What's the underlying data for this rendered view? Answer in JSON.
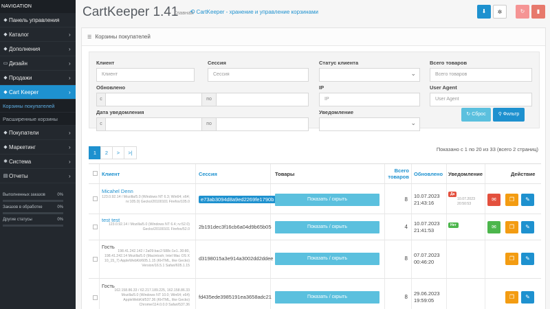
{
  "sidebar": {
    "nav_header": "NAVIGATION",
    "items": [
      {
        "icon": "dashboard-icon",
        "glyph": "◆",
        "label": "Панель управления",
        "chevron": ""
      },
      {
        "icon": "tags-icon",
        "glyph": "◆",
        "label": "Каталог",
        "chevron": "›"
      },
      {
        "icon": "puzzle-icon",
        "glyph": "◆",
        "label": "Дополнения",
        "chevron": "›"
      },
      {
        "icon": "desktop-icon",
        "glyph": "▭",
        "label": "Дизайн",
        "chevron": "›"
      },
      {
        "icon": "cart-icon",
        "glyph": "◆",
        "label": "Продажи",
        "chevron": "›"
      },
      {
        "icon": "cart-keeper-icon",
        "glyph": "◆",
        "label": "Cart Keeper",
        "chevron": "›"
      },
      {
        "icon": "users-icon",
        "glyph": "◆",
        "label": "Покупатели",
        "chevron": "›"
      },
      {
        "icon": "share-icon",
        "glyph": "◆",
        "label": "Маркетинг",
        "chevron": "›"
      },
      {
        "icon": "cog-icon",
        "glyph": "✱",
        "label": "Система",
        "chevron": "›"
      },
      {
        "icon": "bar-chart-icon",
        "glyph": "▤",
        "label": "Отчеты",
        "chevron": "›"
      }
    ],
    "sub_items": [
      "Корзины покупателей",
      "Расширенные корзины"
    ],
    "stats": [
      {
        "label": "Выполненных заказов",
        "pct": "0%"
      },
      {
        "label": "Заказов в обработке",
        "pct": "0%"
      },
      {
        "label": "Другие статусы",
        "pct": "0%"
      }
    ]
  },
  "header": {
    "title": "CartKeeper 1.41",
    "crumb_home": "Главная",
    "crumb_link": "CartKeeper - хранение и управление корзинами",
    "buttons": [
      "download-icon",
      "settings-icon",
      "refresh-icon",
      "trash-icon"
    ]
  },
  "panel": {
    "title": "Корзины покупателей"
  },
  "filter": {
    "client_label": "Клиент",
    "client_placeholder": "Клиент",
    "session_label": "Сессия",
    "session_placeholder": "Сессия",
    "status_label": "Статус клиента",
    "status_value": "",
    "total_label": "Всего товаров",
    "total_placeholder": "Всего товаров",
    "updated_label": "Обновлено",
    "updated_from": "с",
    "updated_to": "по",
    "ip_label": "IP",
    "ip_placeholder": "IP",
    "ua_label": "User Agent",
    "ua_placeholder": "User Agent",
    "notify_date_label": "Дата уведомления",
    "notify_from": "с",
    "notify_to": "по",
    "notify_label": "Уведомление",
    "notify_value": "",
    "reset_label": "↻ Сброс",
    "filter_label": "Фильтр"
  },
  "pagination": {
    "pages": [
      "1",
      "2",
      ">",
      ">|"
    ],
    "info": "Показано с 1 по 20 из 33 (всего 2 страниц)"
  },
  "table": {
    "headers": {
      "client": "Клиент",
      "session": "Сессия",
      "products": "Товары",
      "total": "Всего товаров",
      "updated": "Обновлено",
      "notify": "Уведомление",
      "action": "Действие"
    },
    "toggle_label": "Показать / скрыть",
    "rows": [
      {
        "name": "Micahel Denn",
        "meta": "123.0.92.14 / Mozilla/5.0 (Windows NT 6.3; Win64; x64; rv:105.0) Gecko/20100101 Firefox/105.0",
        "session": "e73ab3094d8a9ed2269fe1790b",
        "qty": "8",
        "updated_date": "10.07.2023",
        "updated_time": "21:43:16",
        "notify_badge": "Да",
        "notify_date": "10.07.2023",
        "notify_time": "20:50:53"
      },
      {
        "name": "test test",
        "meta": "123.0.92.14 / Mozilla/5.0 (Windows NT 6.4; rv:52.0) Gecko/20100101 Firefox/52.0",
        "session": "2b191dec3f16cb6a04d9b65b05",
        "qty": "4",
        "updated_date": "10.07.2023",
        "updated_time": "21:41:53",
        "notify_badge": "Нет",
        "notify_date": "",
        "notify_time": ""
      },
      {
        "name": "Гость",
        "meta": "198.41.242.142 / 2a09:bac2:588c:1e1..30:80, 198.41.242.14 Mozilla/5.0 (Macintosh; Intel Mac OS X 10_15_7) AppleWebKit/605.1.15 (KHTML, like Gecko) Version/16.5.1 Safari/605.1.15",
        "session": "d3198015a3e914a3002dd2ddee",
        "qty": "8",
        "updated_date": "07.07.2023",
        "updated_time": "00:46:20",
        "notify_badge": "",
        "notify_date": "",
        "notify_time": ""
      },
      {
        "name": "Гость",
        "meta": "162.158.86.33 / 62.217.189.225, 162.158.86.33 Mozilla/5.0 (Windows NT 10.0; Win64; x64) AppleWebKit/537.36 (KHTML, like Gecko) Chrome/114.0.0.0 Safari/537.36",
        "session": "fd435ede3985191ea3658adc21",
        "qty": "8",
        "updated_date": "29.06.2023",
        "updated_time": "19:59:05",
        "notify_badge": "",
        "notify_date": "",
        "notify_time": ""
      }
    ]
  },
  "colors": {
    "sidebar_bg": "#23282e",
    "accent": "#1e91cf",
    "info": "#5bc0de",
    "danger": "#e3503e",
    "warning": "#f39c12",
    "success": "#4cb64c"
  }
}
